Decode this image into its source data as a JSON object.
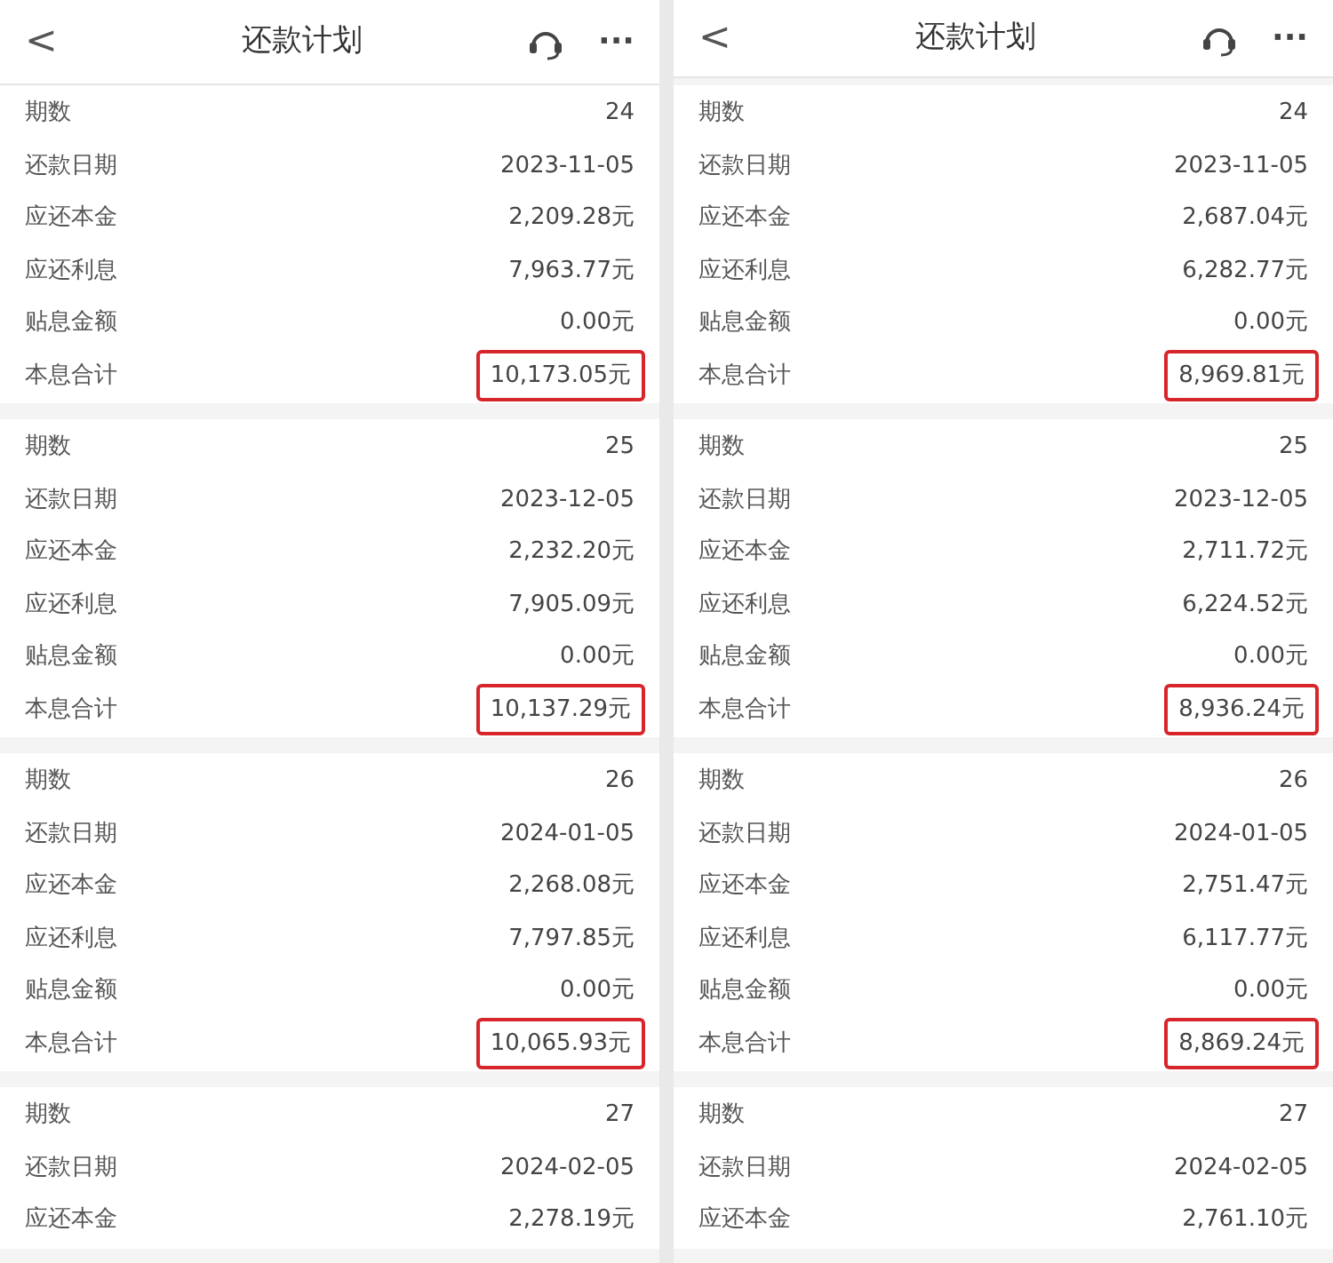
{
  "panels": [
    {
      "title": "还款计划",
      "back": "<",
      "more": "···",
      "periods": [
        {
          "rows": [
            {
              "label": "期数",
              "value": "24",
              "highlighted": false
            },
            {
              "label": "还款日期",
              "value": "2023-11-05",
              "highlighted": false
            },
            {
              "label": "应还本金",
              "value": "2,209.28元",
              "highlighted": false
            },
            {
              "label": "应还利息",
              "value": "7,963.77元",
              "highlighted": false
            },
            {
              "label": "贴息金额",
              "value": "0.00元",
              "highlighted": false
            },
            {
              "label": "本息合计",
              "value": "10,173.05元",
              "highlighted": true
            }
          ]
        },
        {
          "rows": [
            {
              "label": "期数",
              "value": "25",
              "highlighted": false
            },
            {
              "label": "还款日期",
              "value": "2023-12-05",
              "highlighted": false
            },
            {
              "label": "应还本金",
              "value": "2,232.20元",
              "highlighted": false
            },
            {
              "label": "应还利息",
              "value": "7,905.09元",
              "highlighted": false
            },
            {
              "label": "贴息金额",
              "value": "0.00元",
              "highlighted": false
            },
            {
              "label": "本息合计",
              "value": "10,137.29元",
              "highlighted": true
            }
          ]
        },
        {
          "rows": [
            {
              "label": "期数",
              "value": "26",
              "highlighted": false
            },
            {
              "label": "还款日期",
              "value": "2024-01-05",
              "highlighted": false
            },
            {
              "label": "应还本金",
              "value": "2,268.08元",
              "highlighted": false
            },
            {
              "label": "应还利息",
              "value": "7,797.85元",
              "highlighted": false
            },
            {
              "label": "贴息金额",
              "value": "0.00元",
              "highlighted": false
            },
            {
              "label": "本息合计",
              "value": "10,065.93元",
              "highlighted": true
            }
          ]
        },
        {
          "rows": [
            {
              "label": "期数",
              "value": "27",
              "highlighted": false
            },
            {
              "label": "还款日期",
              "value": "2024-02-05",
              "highlighted": false
            },
            {
              "label": "应还本金",
              "value": "2,278.19元",
              "highlighted": false
            }
          ]
        }
      ]
    },
    {
      "title": "还款计划",
      "back": "<",
      "more": "···",
      "periods": [
        {
          "rows": [
            {
              "label": "期数",
              "value": "24",
              "highlighted": false
            },
            {
              "label": "还款日期",
              "value": "2023-11-05",
              "highlighted": false
            },
            {
              "label": "应还本金",
              "value": "2,687.04元",
              "highlighted": false
            },
            {
              "label": "应还利息",
              "value": "6,282.77元",
              "highlighted": false
            },
            {
              "label": "贴息金额",
              "value": "0.00元",
              "highlighted": false
            },
            {
              "label": "本息合计",
              "value": "8,969.81元",
              "highlighted": true
            }
          ]
        },
        {
          "rows": [
            {
              "label": "期数",
              "value": "25",
              "highlighted": false
            },
            {
              "label": "还款日期",
              "value": "2023-12-05",
              "highlighted": false
            },
            {
              "label": "应还本金",
              "value": "2,711.72元",
              "highlighted": false
            },
            {
              "label": "应还利息",
              "value": "6,224.52元",
              "highlighted": false
            },
            {
              "label": "贴息金额",
              "value": "0.00元",
              "highlighted": false
            },
            {
              "label": "本息合计",
              "value": "8,936.24元",
              "highlighted": true
            }
          ]
        },
        {
          "rows": [
            {
              "label": "期数",
              "value": "26",
              "highlighted": false
            },
            {
              "label": "还款日期",
              "value": "2024-01-05",
              "highlighted": false
            },
            {
              "label": "应还本金",
              "value": "2,751.47元",
              "highlighted": false
            },
            {
              "label": "应还利息",
              "value": "6,117.77元",
              "highlighted": false
            },
            {
              "label": "贴息金额",
              "value": "0.00元",
              "highlighted": false
            },
            {
              "label": "本息合计",
              "value": "8,869.24元",
              "highlighted": true
            }
          ]
        },
        {
          "rows": [
            {
              "label": "期数",
              "value": "27",
              "highlighted": false
            },
            {
              "label": "还款日期",
              "value": "2024-02-05",
              "highlighted": false
            },
            {
              "label": "应还本金",
              "value": "2,761.10元",
              "highlighted": false
            }
          ]
        }
      ]
    }
  ]
}
